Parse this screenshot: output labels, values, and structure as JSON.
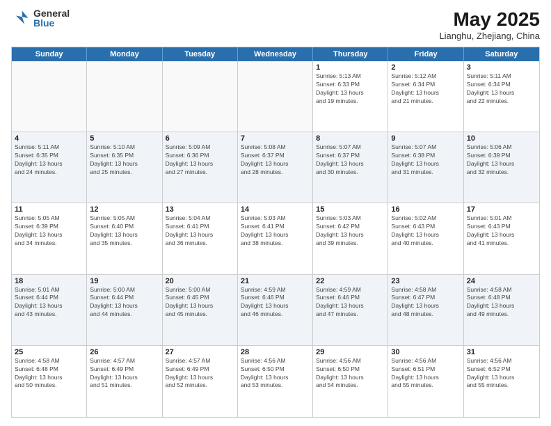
{
  "logo": {
    "general": "General",
    "blue": "Blue"
  },
  "title": "May 2025",
  "location": "Lianghu, Zhejiang, China",
  "weekdays": [
    "Sunday",
    "Monday",
    "Tuesday",
    "Wednesday",
    "Thursday",
    "Friday",
    "Saturday"
  ],
  "weeks": [
    [
      {
        "day": "",
        "info": ""
      },
      {
        "day": "",
        "info": ""
      },
      {
        "day": "",
        "info": ""
      },
      {
        "day": "",
        "info": ""
      },
      {
        "day": "1",
        "info": "Sunrise: 5:13 AM\nSunset: 6:33 PM\nDaylight: 13 hours\nand 19 minutes."
      },
      {
        "day": "2",
        "info": "Sunrise: 5:12 AM\nSunset: 6:34 PM\nDaylight: 13 hours\nand 21 minutes."
      },
      {
        "day": "3",
        "info": "Sunrise: 5:11 AM\nSunset: 6:34 PM\nDaylight: 13 hours\nand 22 minutes."
      }
    ],
    [
      {
        "day": "4",
        "info": "Sunrise: 5:11 AM\nSunset: 6:35 PM\nDaylight: 13 hours\nand 24 minutes."
      },
      {
        "day": "5",
        "info": "Sunrise: 5:10 AM\nSunset: 6:35 PM\nDaylight: 13 hours\nand 25 minutes."
      },
      {
        "day": "6",
        "info": "Sunrise: 5:09 AM\nSunset: 6:36 PM\nDaylight: 13 hours\nand 27 minutes."
      },
      {
        "day": "7",
        "info": "Sunrise: 5:08 AM\nSunset: 6:37 PM\nDaylight: 13 hours\nand 28 minutes."
      },
      {
        "day": "8",
        "info": "Sunrise: 5:07 AM\nSunset: 6:37 PM\nDaylight: 13 hours\nand 30 minutes."
      },
      {
        "day": "9",
        "info": "Sunrise: 5:07 AM\nSunset: 6:38 PM\nDaylight: 13 hours\nand 31 minutes."
      },
      {
        "day": "10",
        "info": "Sunrise: 5:06 AM\nSunset: 6:39 PM\nDaylight: 13 hours\nand 32 minutes."
      }
    ],
    [
      {
        "day": "11",
        "info": "Sunrise: 5:05 AM\nSunset: 6:39 PM\nDaylight: 13 hours\nand 34 minutes."
      },
      {
        "day": "12",
        "info": "Sunrise: 5:05 AM\nSunset: 6:40 PM\nDaylight: 13 hours\nand 35 minutes."
      },
      {
        "day": "13",
        "info": "Sunrise: 5:04 AM\nSunset: 6:41 PM\nDaylight: 13 hours\nand 36 minutes."
      },
      {
        "day": "14",
        "info": "Sunrise: 5:03 AM\nSunset: 6:41 PM\nDaylight: 13 hours\nand 38 minutes."
      },
      {
        "day": "15",
        "info": "Sunrise: 5:03 AM\nSunset: 6:42 PM\nDaylight: 13 hours\nand 39 minutes."
      },
      {
        "day": "16",
        "info": "Sunrise: 5:02 AM\nSunset: 6:43 PM\nDaylight: 13 hours\nand 40 minutes."
      },
      {
        "day": "17",
        "info": "Sunrise: 5:01 AM\nSunset: 6:43 PM\nDaylight: 13 hours\nand 41 minutes."
      }
    ],
    [
      {
        "day": "18",
        "info": "Sunrise: 5:01 AM\nSunset: 6:44 PM\nDaylight: 13 hours\nand 43 minutes."
      },
      {
        "day": "19",
        "info": "Sunrise: 5:00 AM\nSunset: 6:44 PM\nDaylight: 13 hours\nand 44 minutes."
      },
      {
        "day": "20",
        "info": "Sunrise: 5:00 AM\nSunset: 6:45 PM\nDaylight: 13 hours\nand 45 minutes."
      },
      {
        "day": "21",
        "info": "Sunrise: 4:59 AM\nSunset: 6:46 PM\nDaylight: 13 hours\nand 46 minutes."
      },
      {
        "day": "22",
        "info": "Sunrise: 4:59 AM\nSunset: 6:46 PM\nDaylight: 13 hours\nand 47 minutes."
      },
      {
        "day": "23",
        "info": "Sunrise: 4:58 AM\nSunset: 6:47 PM\nDaylight: 13 hours\nand 48 minutes."
      },
      {
        "day": "24",
        "info": "Sunrise: 4:58 AM\nSunset: 6:48 PM\nDaylight: 13 hours\nand 49 minutes."
      }
    ],
    [
      {
        "day": "25",
        "info": "Sunrise: 4:58 AM\nSunset: 6:48 PM\nDaylight: 13 hours\nand 50 minutes."
      },
      {
        "day": "26",
        "info": "Sunrise: 4:57 AM\nSunset: 6:49 PM\nDaylight: 13 hours\nand 51 minutes."
      },
      {
        "day": "27",
        "info": "Sunrise: 4:57 AM\nSunset: 6:49 PM\nDaylight: 13 hours\nand 52 minutes."
      },
      {
        "day": "28",
        "info": "Sunrise: 4:56 AM\nSunset: 6:50 PM\nDaylight: 13 hours\nand 53 minutes."
      },
      {
        "day": "29",
        "info": "Sunrise: 4:56 AM\nSunset: 6:50 PM\nDaylight: 13 hours\nand 54 minutes."
      },
      {
        "day": "30",
        "info": "Sunrise: 4:56 AM\nSunset: 6:51 PM\nDaylight: 13 hours\nand 55 minutes."
      },
      {
        "day": "31",
        "info": "Sunrise: 4:56 AM\nSunset: 6:52 PM\nDaylight: 13 hours\nand 55 minutes."
      }
    ]
  ]
}
